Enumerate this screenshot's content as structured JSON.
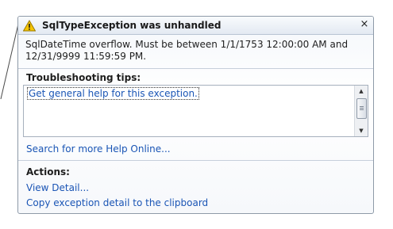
{
  "dialog": {
    "title": "SqlTypeException was unhandled",
    "message": "SqlDateTime overflow. Must be between 1/1/1753 12:00:00 AM and 12/31/9999 11:59:59 PM.",
    "close_glyph": "×",
    "icons": {
      "warning": "warning-icon",
      "close": "close-icon"
    }
  },
  "tips": {
    "heading": "Troubleshooting tips:",
    "items": [
      "Get general help for this exception."
    ]
  },
  "search_link": "Search for more Help Online...",
  "actions": {
    "heading": "Actions:",
    "items": [
      "View Detail...",
      "Copy exception detail to the clipboard"
    ]
  },
  "colors": {
    "link": "#1a55b5",
    "warning_fill": "#f5c400"
  }
}
